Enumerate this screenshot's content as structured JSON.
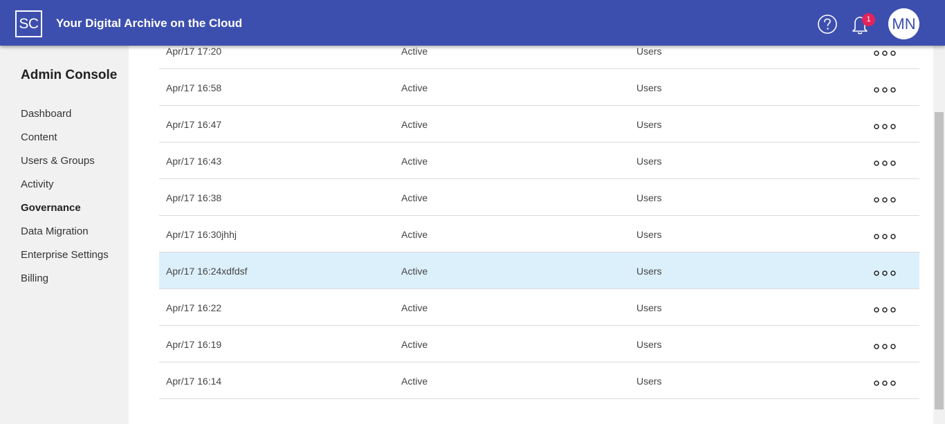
{
  "header": {
    "logo_text": "SC",
    "title": "Your Digital Archive on the Cloud",
    "help_icon": "question-circle-icon",
    "bell_icon": "bell-icon",
    "notification_count": "1",
    "avatar_initials": "MN"
  },
  "sidebar": {
    "title": "Admin Console",
    "items": [
      {
        "label": "Dashboard",
        "active": false
      },
      {
        "label": "Content",
        "active": false
      },
      {
        "label": "Users & Groups",
        "active": false
      },
      {
        "label": "Activity",
        "active": false
      },
      {
        "label": "Governance",
        "active": true
      },
      {
        "label": "Data Migration",
        "active": false
      },
      {
        "label": "Enterprise Settings",
        "active": false
      },
      {
        "label": "Billing",
        "active": false
      }
    ]
  },
  "table": {
    "rows": [
      {
        "date": "Apr/17 17:20",
        "status": "Active",
        "type": "Users",
        "selected": false
      },
      {
        "date": "Apr/17 16:58",
        "status": "Active",
        "type": "Users",
        "selected": false
      },
      {
        "date": "Apr/17 16:47",
        "status": "Active",
        "type": "Users",
        "selected": false
      },
      {
        "date": "Apr/17 16:43",
        "status": "Active",
        "type": "Users",
        "selected": false
      },
      {
        "date": "Apr/17 16:38",
        "status": "Active",
        "type": "Users",
        "selected": false
      },
      {
        "date": "Apr/17 16:30jhhj",
        "status": "Active",
        "type": "Users",
        "selected": false
      },
      {
        "date": "Apr/17 16:24xdfdsf",
        "status": "Active",
        "type": "Users",
        "selected": true
      },
      {
        "date": "Apr/17 16:22",
        "status": "Active",
        "type": "Users",
        "selected": false
      },
      {
        "date": "Apr/17 16:19",
        "status": "Active",
        "type": "Users",
        "selected": false
      },
      {
        "date": "Apr/17 16:14",
        "status": "Active",
        "type": "Users",
        "selected": false
      }
    ],
    "more_icon": "more-options-icon"
  },
  "colors": {
    "header_bg": "#3d4fae",
    "badge": "#e3245c",
    "selected_row": "#dcf0fb",
    "sidebar_bg": "#f1f1f1"
  }
}
